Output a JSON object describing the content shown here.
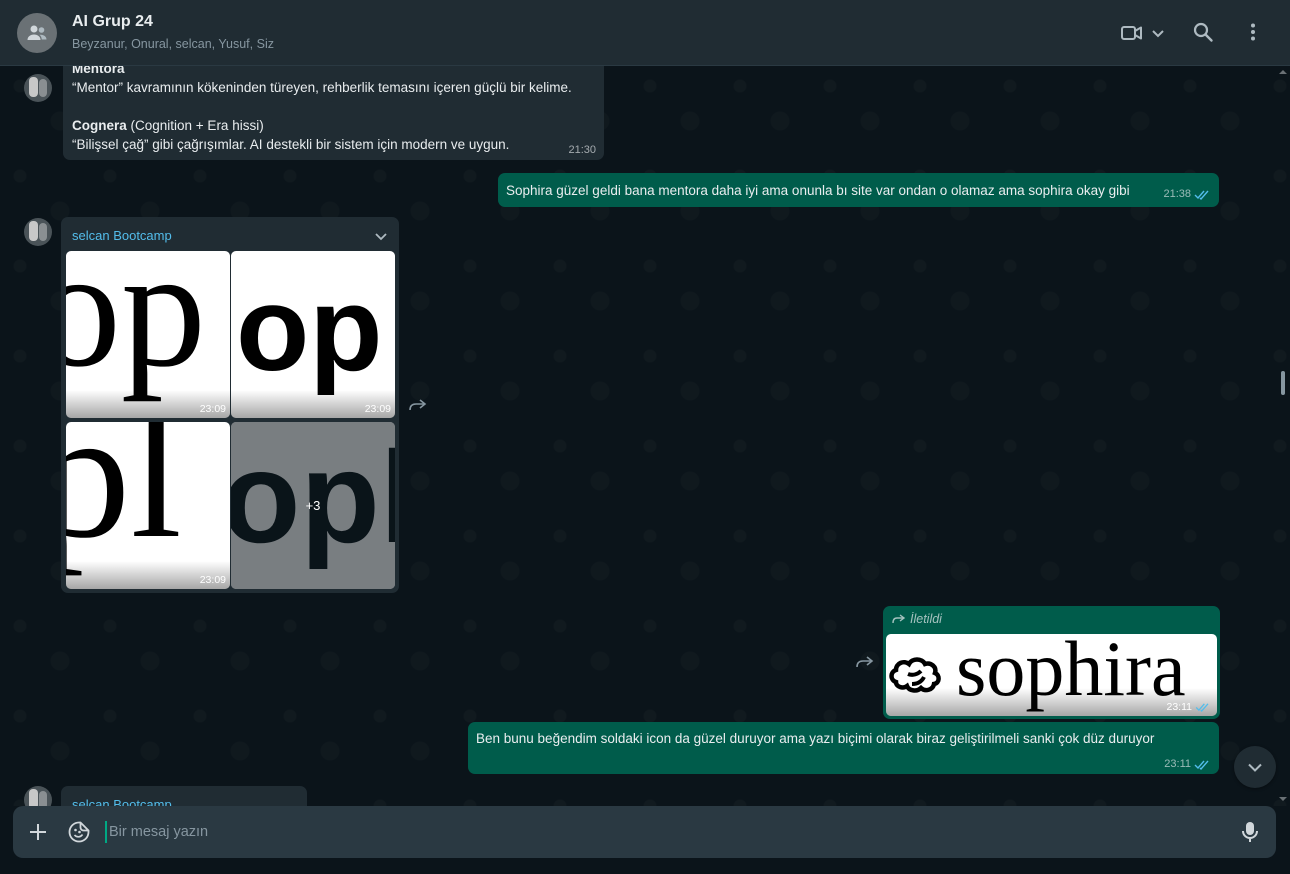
{
  "header": {
    "title": "AI Grup 24",
    "members": "Beyzanur, Onural, selcan, Yusuf, Siz"
  },
  "messages": {
    "m1": {
      "heading": "Mentora",
      "line1": "“Mentor” kavramının kökeninden türeyen, rehberlik temasını içeren güçlü bir kelime.",
      "heading2": "Cognera",
      "heading2_note": " (Cognition + Era hissi)",
      "line2": " “Bilişsel çağ” gibi çağrışımlar. AI destekli bir sistem için modern ve uygun.",
      "time": "21:30"
    },
    "m2": {
      "text": "Sophira güzel geldi bana mentora daha iyi ama onunla bı site var ondan o olamaz ama sophira okay gibi",
      "time": "21:38"
    },
    "m3": {
      "sender": "selcan Bootcamp",
      "tiles": [
        {
          "glyph": "op",
          "time": "23:09"
        },
        {
          "glyph": "op",
          "time": "23:09"
        },
        {
          "glyph": "pl",
          "time": "23:09"
        },
        {
          "glyph": "opl",
          "more": "+3"
        }
      ]
    },
    "m4": {
      "forwarded_label": "İletildi",
      "image_text": "sophira",
      "time": "23:11"
    },
    "m5": {
      "text": "Ben bunu beğendim  soldaki icon da güzel duruyor ama yazı biçimi olarak biraz geliştirilmeli sanki çok düz duruyor",
      "time": "23:11"
    },
    "m6": {
      "sender": "selcan Bootcamp"
    }
  },
  "composer": {
    "placeholder": "Bir mesaj yazın"
  },
  "icons": {
    "group_avatar": "users-icon",
    "video": "video-call-icon",
    "search": "search-icon",
    "menu": "more-vertical-icon",
    "attach": "plus-icon",
    "sticker": "sticker-icon",
    "mic": "microphone-icon",
    "scroll_down": "chevron-down-icon",
    "forward": "forward-icon",
    "read": "double-check-icon"
  },
  "colors": {
    "background": "#0b141a",
    "header": "#202c33",
    "incoming": "#202c33",
    "outgoing": "#005c4b",
    "sender_name": "#53bdeb",
    "read_receipt": "#53bdeb"
  }
}
